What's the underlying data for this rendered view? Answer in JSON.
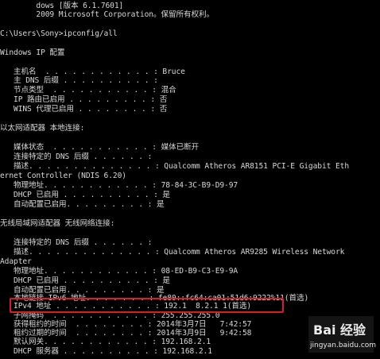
{
  "console": {
    "lines": [
      "        dows [版本 6.1.7601]",
      "        2009 Microsoft Corporation。保留所有权利。",
      "",
      "C:\\Users\\Sony>ipconfig/all",
      "",
      "Windows IP 配置",
      "",
      "   主机名  . . . . . . . . . . . . : Bruce",
      "   主 DNS 后缀 . . . . . . . . . . :",
      "   节点类型  . . . . . . . . . . . : 混合",
      "   IP 路由已启用 . . . . . . . . . : 否",
      "   WINS 代理已启用 . . . . . . . . : 否",
      "",
      "以太网适配器 本地连接:",
      "",
      "   媒体状态  . . . . . . . . . . . : 媒体已断开",
      "   连接特定的 DNS 后缀 . . . . . . :",
      "   描述. . . . . . . . . . . . . . : Qualcomm Atheros AR8151 PCI-E Gigabit Eth",
      "ernet Controller (NDIS 6.20)",
      "   物理地址. . . . . . . . . . . . : 78-84-3C-B9-D9-97",
      "   DHCP 已启用 . . . . . . . . . . : 是",
      "   自动配置已启用. . . . . . . . . : 是",
      "",
      "无线局域网适配器 无线网络连接:",
      "",
      "   连接特定的 DNS 后缀 . . . . . . :",
      "   描述. . . . . . . . . . . . . . : Qualcomm Atheros AR9285 Wireless Network",
      "Adapter",
      "   物理地址. . . . . . . . . . . . : 08-ED-B9-C3-E9-9A",
      "   DHCP 已启用 . . . . . . . . . . : 是",
      "   自动配置已启用. . . . . . . . . : 是",
      "   本地链接 IPv6 地址. . . . . . . : fe80::fc64:ca01:51d6:9222%11(首选)",
      "   IPv4 地址 . . . . . . . . . . . : 192.1  8.2.1 1(首选)",
      "   子网掩码  . . . . . . . . . . . : 255.255.255.0",
      "   获得租约的时间  . . . . . . . . : 2014年3月7日   7:42:57",
      "   租约过期的时间  . . . . . . . . : 2014年3月9日   9:42:58",
      "   默认网关. . . . . . . . . . . . : 192.168.2.1",
      "   DHCP 服务器 . . . . . . . . . . : 192.168.2.1"
    ]
  },
  "colors": {
    "background": "#000000",
    "text": "#d8d8d8",
    "highlight_border": "#d2202a"
  },
  "watermark": {
    "logo": "Bai  经验",
    "url": "jingyan.baidu.com"
  }
}
